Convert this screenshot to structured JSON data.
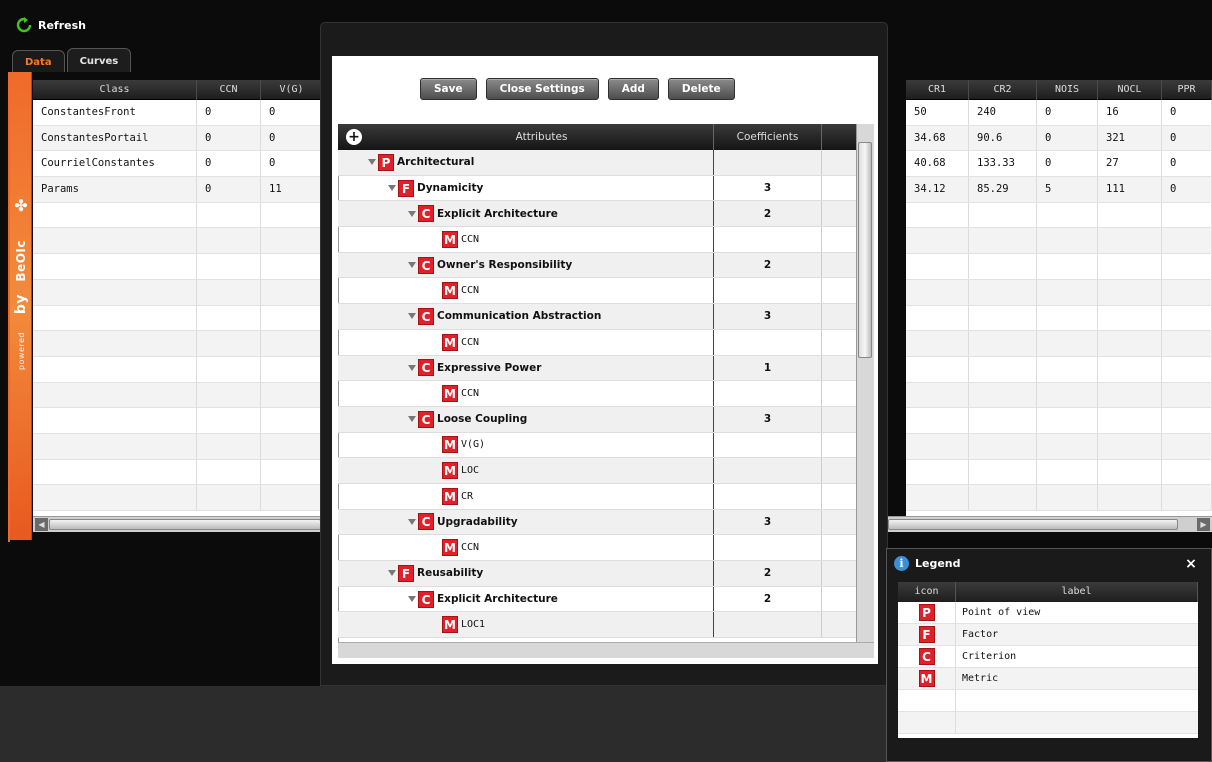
{
  "toolbar": {
    "refresh_label": "Refresh"
  },
  "tabs": [
    {
      "label": "Data",
      "active": true
    },
    {
      "label": "Curves",
      "active": false
    }
  ],
  "sidebar": {
    "brand": "BeOIc",
    "powered": "powered",
    "by": "by"
  },
  "left_grid": {
    "columns": [
      "Class",
      "CCN",
      "V(G)"
    ],
    "rows": [
      [
        "ConstantesFront",
        "0",
        "0"
      ],
      [
        "ConstantesPortail",
        "0",
        "0"
      ],
      [
        "CourrielConstantes",
        "0",
        "0"
      ],
      [
        "Params",
        "0",
        "11"
      ]
    ]
  },
  "right_grid": {
    "columns": [
      "CR1",
      "CR2",
      "NOIS",
      "NOCL",
      "PPR"
    ],
    "rows": [
      [
        "50",
        "240",
        "0",
        "16",
        "0"
      ],
      [
        "34.68",
        "90.6",
        "0",
        "321",
        "0"
      ],
      [
        "40.68",
        "133.33",
        "0",
        "27",
        "0"
      ],
      [
        "34.12",
        "85.29",
        "5",
        "111",
        "0"
      ]
    ]
  },
  "settings": {
    "buttons": {
      "save": "Save",
      "close": "Close Settings",
      "add": "Add",
      "delete": "Delete"
    },
    "headers": {
      "attributes": "Attributes",
      "coefficients": "Coefficients",
      "add_icon": "+"
    },
    "tree": [
      {
        "level": 0,
        "type": "P",
        "label": "Architectural",
        "coef": ""
      },
      {
        "level": 1,
        "type": "F",
        "label": "Dynamicity",
        "coef": "3"
      },
      {
        "level": 2,
        "type": "C",
        "label": "Explicit Architecture",
        "coef": "2"
      },
      {
        "level": 3,
        "type": "M",
        "label": "CCN",
        "coef": ""
      },
      {
        "level": 2,
        "type": "C",
        "label": "Owner's Responsibility",
        "coef": "2"
      },
      {
        "level": 3,
        "type": "M",
        "label": "CCN",
        "coef": ""
      },
      {
        "level": 2,
        "type": "C",
        "label": "Communication Abstraction",
        "coef": "3"
      },
      {
        "level": 3,
        "type": "M",
        "label": "CCN",
        "coef": ""
      },
      {
        "level": 2,
        "type": "C",
        "label": "Expressive Power",
        "coef": "1"
      },
      {
        "level": 3,
        "type": "M",
        "label": "CCN",
        "coef": ""
      },
      {
        "level": 2,
        "type": "C",
        "label": "Loose Coupling",
        "coef": "3"
      },
      {
        "level": 3,
        "type": "M",
        "label": "V(G)",
        "coef": ""
      },
      {
        "level": 3,
        "type": "M",
        "label": "LOC",
        "coef": ""
      },
      {
        "level": 3,
        "type": "M",
        "label": "CR",
        "coef": ""
      },
      {
        "level": 2,
        "type": "C",
        "label": "Upgradability",
        "coef": "3"
      },
      {
        "level": 3,
        "type": "M",
        "label": "CCN",
        "coef": ""
      },
      {
        "level": 1,
        "type": "F",
        "label": "Reusability",
        "coef": "2"
      },
      {
        "level": 2,
        "type": "C",
        "label": "Explicit Architecture",
        "coef": "2"
      },
      {
        "level": 3,
        "type": "M",
        "label": "LOC1",
        "coef": ""
      }
    ]
  },
  "legend": {
    "title": "Legend",
    "close_icon": "×",
    "columns": [
      "icon",
      "label"
    ],
    "items": [
      {
        "icon": "P",
        "label": "Point of view"
      },
      {
        "icon": "F",
        "label": "Factor"
      },
      {
        "icon": "C",
        "label": "Criterion"
      },
      {
        "icon": "M",
        "label": "Metric"
      }
    ]
  },
  "colors": {
    "accent": "#f2682a",
    "badge": "#e0202a",
    "dark": "#0b0b0b"
  }
}
